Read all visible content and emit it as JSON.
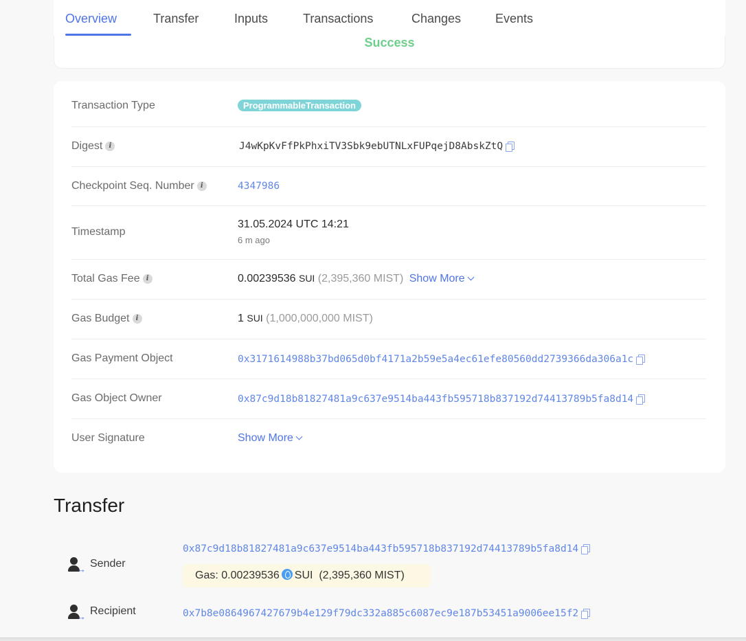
{
  "tabs": [
    {
      "label": "Overview",
      "active": true
    },
    {
      "label": "Transfer"
    },
    {
      "label": "Inputs"
    },
    {
      "label": "Transactions"
    },
    {
      "label": "Changes"
    },
    {
      "label": "Events"
    }
  ],
  "status": "Success",
  "details": {
    "transaction_type": {
      "label": "Transaction Type",
      "value": "ProgrammableTransaction"
    },
    "digest": {
      "label": "Digest",
      "value": "J4wKpKvFfPkPhxiTV3Sbk9ebUTNLxFUPqejD8AbskZtQ"
    },
    "checkpoint": {
      "label": "Checkpoint Seq. Number",
      "value": "4347986"
    },
    "timestamp": {
      "label": "Timestamp",
      "value": "31.05.2024 UTC 14:21",
      "relative": "6 m ago"
    },
    "total_gas_fee": {
      "label": "Total Gas Fee",
      "amount": "0.00239536",
      "unit": "SUI",
      "mist": "(2,395,360 MIST)",
      "show_more": "Show More"
    },
    "gas_budget": {
      "label": "Gas Budget",
      "amount": "1",
      "unit": "SUI",
      "mist": "(1,000,000,000 MIST)"
    },
    "gas_payment_object": {
      "label": "Gas Payment Object",
      "value": "0x3171614988b37bd065d0bf4171a2b59e5a4ec61efe80560dd2739366da306a1c"
    },
    "gas_object_owner": {
      "label": "Gas Object Owner",
      "value": "0x87c9d18b81827481a9c637e9514ba443fb595718b837192d74413789b5fa8d14"
    },
    "user_signature": {
      "label": "User Signature",
      "show_more": "Show More"
    }
  },
  "transfer": {
    "title": "Transfer",
    "sender": {
      "label": "Sender",
      "address": "0x87c9d18b81827481a9c637e9514ba443fb595718b837192d74413789b5fa8d14"
    },
    "gas": {
      "prefix": "Gas: 0.00239536",
      "unit": "SUI",
      "mist": "(2,395,360 MIST)"
    },
    "recipient": {
      "label": "Recipient",
      "address": "0x7b8e0864967427679b4e129f79dc332a885c6087ec9e187b53451a9006ee15f2"
    }
  },
  "colors": {
    "accent": "#4f74e8",
    "success": "#6dcf8c",
    "badge": "#7fd4d8",
    "link": "#6087e6"
  }
}
